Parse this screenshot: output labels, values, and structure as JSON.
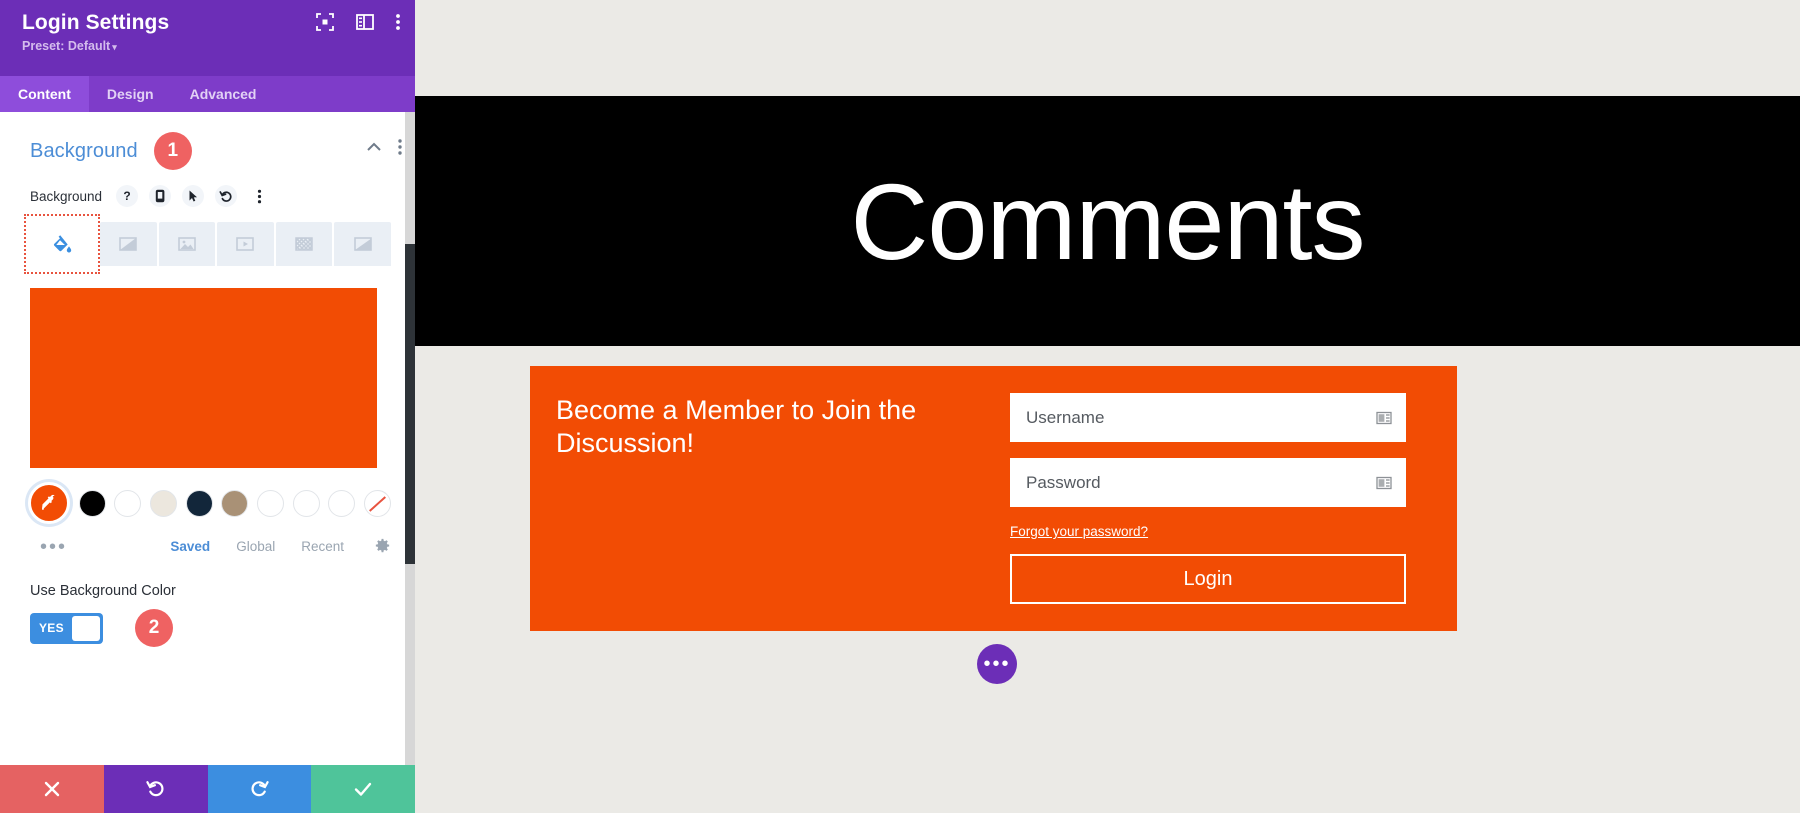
{
  "panel": {
    "title": "Login Settings",
    "preset_label": "Preset: Default",
    "preset_caret": "▾",
    "header_icons": [
      {
        "name": "focus-target-icon"
      },
      {
        "name": "layout-panel-icon"
      },
      {
        "name": "more-vertical-icon"
      }
    ],
    "tabs": [
      {
        "label": "Content",
        "active": true
      },
      {
        "label": "Design",
        "active": false
      },
      {
        "label": "Advanced",
        "active": false
      }
    ],
    "section": {
      "title": "Background",
      "badge": "1",
      "collapse_icon": "chevron-up-icon",
      "menu_icon": "more-vertical-icon"
    },
    "field": {
      "label": "Background",
      "tool_icons": [
        {
          "name": "help-icon",
          "glyph": "?"
        },
        {
          "name": "mobile-responsive-icon"
        },
        {
          "name": "hover-cursor-icon"
        },
        {
          "name": "reset-undo-icon"
        },
        {
          "name": "more-vertical-icon"
        }
      ]
    },
    "background_types": [
      {
        "name": "bg-color-tab",
        "icon": "paint-bucket-icon",
        "active": true
      },
      {
        "name": "bg-gradient-tab",
        "icon": "gradient-icon",
        "active": false
      },
      {
        "name": "bg-image-tab",
        "icon": "image-icon",
        "active": false
      },
      {
        "name": "bg-video-tab",
        "icon": "video-icon",
        "active": false
      },
      {
        "name": "bg-pattern-tab",
        "icon": "pattern-icon",
        "active": false
      },
      {
        "name": "bg-mask-tab",
        "icon": "mask-icon",
        "active": false
      }
    ],
    "selected_color": "#f24c04",
    "swatches": [
      {
        "name": "eyedropper-swatch",
        "color": "#f24c04",
        "type": "eyedropper"
      },
      {
        "name": "swatch-black",
        "color": "#000000",
        "type": "color"
      },
      {
        "name": "swatch-white",
        "color": "#ffffff",
        "type": "color"
      },
      {
        "name": "swatch-cream",
        "color": "#ece7de",
        "type": "color"
      },
      {
        "name": "swatch-navy",
        "color": "#12263a",
        "type": "color"
      },
      {
        "name": "swatch-tan",
        "color": "#a99176",
        "type": "color"
      },
      {
        "name": "swatch-empty-1",
        "color": "#ffffff",
        "type": "color"
      },
      {
        "name": "swatch-empty-2",
        "color": "#ffffff",
        "type": "color"
      },
      {
        "name": "swatch-empty-3",
        "color": "#ffffff",
        "type": "color"
      },
      {
        "name": "swatch-none",
        "color": "#ffffff",
        "type": "none"
      }
    ],
    "swatch_tools": {
      "more_dots": "•••",
      "links": [
        {
          "label": "Saved",
          "active": true
        },
        {
          "label": "Global",
          "active": false
        },
        {
          "label": "Recent",
          "active": false
        }
      ],
      "gear_icon": "gear-icon"
    },
    "toggle": {
      "label": "Use Background Color",
      "value": "YES",
      "badge": "2"
    },
    "footer_buttons": [
      {
        "name": "cancel-button",
        "icon": "close-icon",
        "color": "#e56262"
      },
      {
        "name": "undo-button",
        "icon": "undo-icon",
        "color": "#6c2eb7"
      },
      {
        "name": "redo-button",
        "icon": "redo-icon",
        "color": "#3c8ee0"
      },
      {
        "name": "save-button",
        "icon": "check-icon",
        "color": "#4fc49a"
      }
    ]
  },
  "preview": {
    "hero_title": "Comments",
    "login": {
      "heading": "Become a Member to Join the Discussion!",
      "username_placeholder": "Username",
      "password_placeholder": "Password",
      "forgot_link": "Forgot your password?",
      "login_button": "Login",
      "card_color": "#f24c04"
    },
    "fab_label": "•••"
  }
}
